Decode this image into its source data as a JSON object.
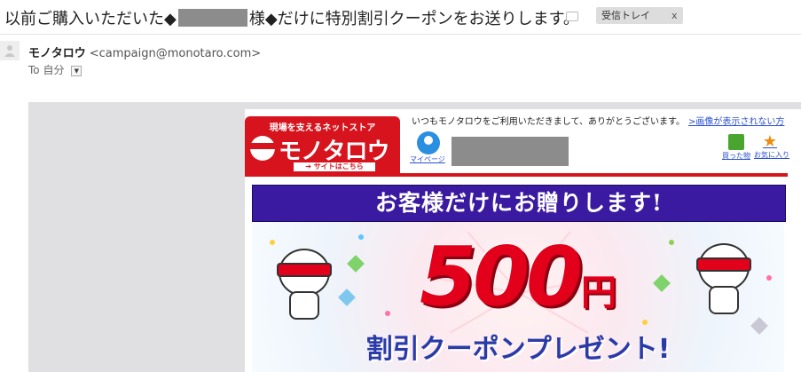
{
  "subject": {
    "prefix": "以前ご購入いただいた◆",
    "suffix": "様◆だけに特別割引クーポンをお送りします。",
    "label_tag": "受信トレイ",
    "label_close": "x"
  },
  "sender": {
    "name": "モノタロウ",
    "email": "<campaign@monotaro.com>"
  },
  "recipient": {
    "prefix": "To",
    "name": "自分"
  },
  "email_body": {
    "logo_tagline": "現場を支えるネットストア",
    "logo_name": "モノタロウ",
    "logo_site_link": "➔ サイトはこちら",
    "greeting": "いつもモノタロウをご利用いただきまして、ありがとうございます。",
    "image_link": ">画像が表示されない方",
    "mypage_label": "マイページ",
    "bought_label": "買った物",
    "favorites_label": "お気に入り",
    "banner_text": "お客様だけにお贈りします!",
    "discount_amount": "500",
    "discount_unit": "円",
    "coupon_text": "割引クーポンプレゼント!"
  },
  "colors": {
    "brand_red": "#d7141e",
    "banner_purple": "#3a1aa0",
    "coupon_blue": "#2a3aa8"
  }
}
